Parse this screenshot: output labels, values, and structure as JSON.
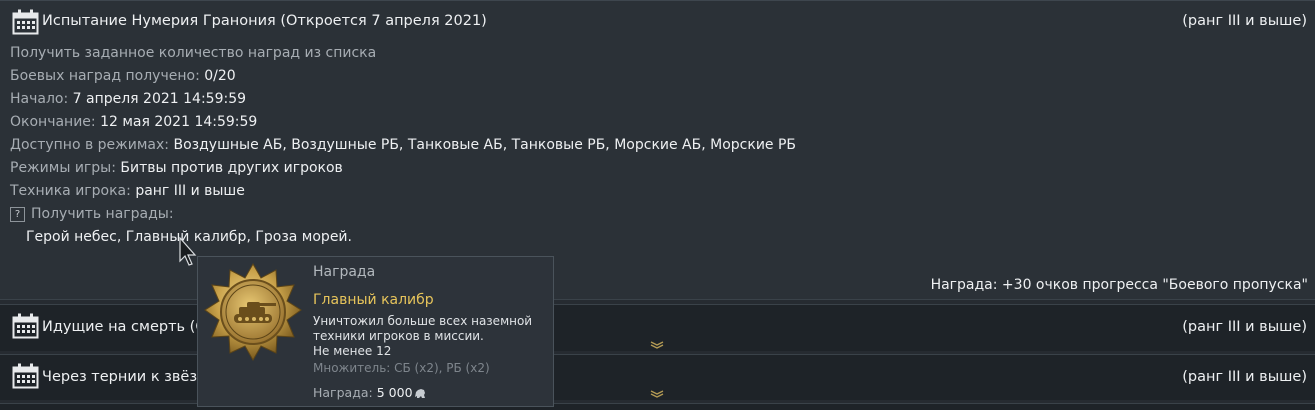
{
  "panels": [
    {
      "title": "Испытание Нумерия Гранония (Откроется 7 апреля 2021)",
      "rank": "(ранг III и выше)",
      "description": "Получить заданное количество наград из списка",
      "progress_label": "Боевых наград получено:",
      "progress_value": "0/20",
      "start_label": "Начало:",
      "start_value": "7 апреля 2021 14:59:59",
      "end_label": "Окончание:",
      "end_value": "12 мая 2021 14:59:59",
      "modes_label": "Доступно в режимах:",
      "modes_value": "Воздушные АБ, Воздушные РБ, Танковые АБ, Танковые РБ, Морские АБ, Морские РБ",
      "gamemodes_label": "Режимы игры:",
      "gamemodes_value": "Битвы против других игроков",
      "vehicle_label": "Техника игрока:",
      "vehicle_value": "ранг III и выше",
      "awards_label": "Получить награды:",
      "awards_value": "Герой небес, Главный калибр, Гроза морей.",
      "reward_text": "Награда: +30 очков прогресса \"Боевого пропуска\""
    },
    {
      "title": "Идущие на смерть (От",
      "rank": "(ранг III и выше)"
    },
    {
      "title": "Через тернии к звёзд",
      "rank": "(ранг III и выше)"
    }
  ],
  "tooltip": {
    "header": "Награда",
    "name": "Главный калибр",
    "description": "Уничтожил больше всех наземной техники игроков в миссии.",
    "minimum": "Не менее 12",
    "multiplier": "Множитель: СБ (x2), РБ (x2)",
    "reward_label": "Награда:",
    "reward_value": "5 000"
  },
  "icons": {
    "calendar": "calendar-icon",
    "help": "question-icon",
    "medal": "tank-medal-icon",
    "currency": "silver-lion-icon",
    "expand": "chevron-down-icon",
    "cursor": "mouse-cursor-icon"
  },
  "colors": {
    "background": "#262b31",
    "panel": "#2b3137",
    "collapsed_panel": "#1e2328",
    "label": "#a7adb3",
    "value": "#eef0f2",
    "accent_gold": "#e6c45b"
  }
}
